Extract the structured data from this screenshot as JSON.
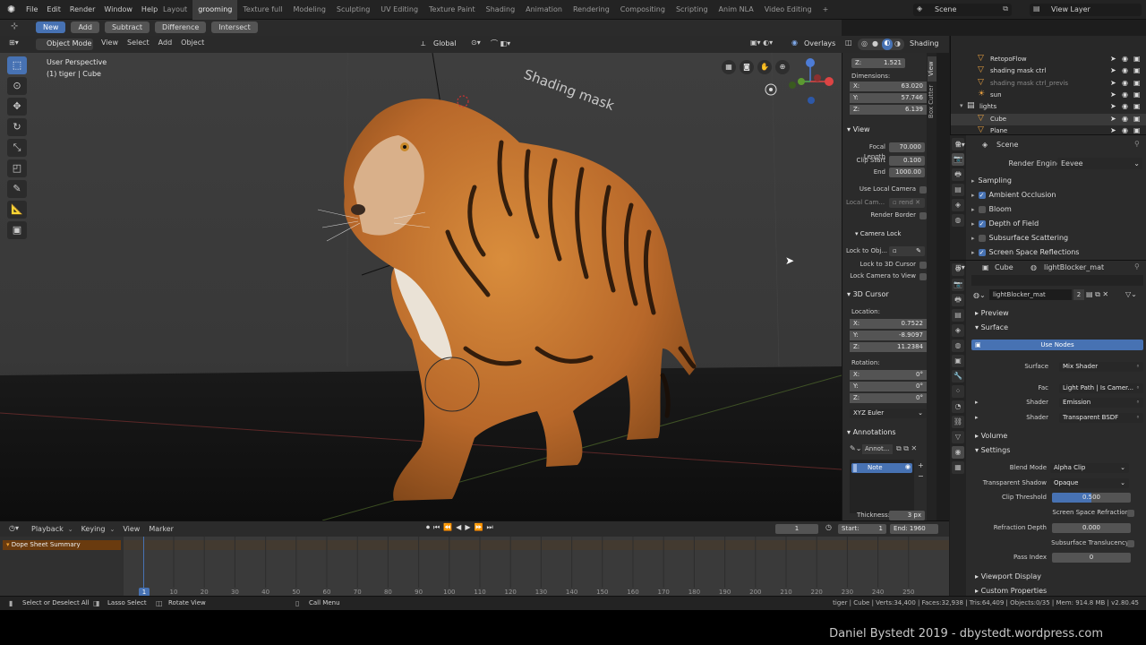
{
  "topbar": {
    "menus": [
      "File",
      "Edit",
      "Render",
      "Window",
      "Help"
    ],
    "workspaces": [
      "Layout",
      "grooming",
      "Texture full",
      "Modeling",
      "Sculpting",
      "UV Editing",
      "Texture Paint",
      "Shading",
      "Animation",
      "Rendering",
      "Compositing",
      "Scripting",
      "Anim NLA",
      "Video Editing",
      "+"
    ],
    "active_workspace": "grooming",
    "scene": "Scene",
    "view_layer": "View Layer"
  },
  "toolheader": {
    "modes": [
      "New",
      "Add",
      "Subtract",
      "Difference",
      "Intersect"
    ]
  },
  "viewport_header": {
    "mode": "Object Mode",
    "menus": [
      "View",
      "Select",
      "Add",
      "Object"
    ],
    "orientation": "Global",
    "overlays": "Overlays",
    "shading": "Shading"
  },
  "viewport": {
    "perspective": "User Perspective",
    "object_info": "(1) tiger | Cube",
    "overlay_text": "Shading mask"
  },
  "npanel": {
    "tabs": [
      "View",
      "Box Cutter"
    ],
    "dim_z_top": "1.521",
    "dimensions_label": "Dimensions:",
    "dimensions": [
      {
        "axis": "X:",
        "value": "63.020"
      },
      {
        "axis": "Y:",
        "value": "57.746"
      },
      {
        "axis": "Z:",
        "value": "6.139"
      }
    ],
    "view_title": "View",
    "focal_length_label": "Focal Length",
    "focal_length": "70.000",
    "clip_start_label": "Clip Start",
    "clip_start": "0.100",
    "clip_end_label": "End",
    "clip_end": "1000.00",
    "use_local_camera": "Use Local Camera",
    "local_camera": "Local Cam...",
    "local_camera_value": "rend",
    "render_border": "Render Border",
    "camera_lock": "Camera Lock",
    "lock_to_obj": "Lock to Obj...",
    "lock_to_3d_cursor": "Lock to 3D Cursor",
    "lock_camera_to_view": "Lock Camera to View",
    "cursor_title": "3D Cursor",
    "location_label": "Location:",
    "location": [
      {
        "axis": "X:",
        "value": "0.7522"
      },
      {
        "axis": "Y:",
        "value": "-8.9097"
      },
      {
        "axis": "Z:",
        "value": "11.2384"
      }
    ],
    "rotation_label": "Rotation:",
    "rotation": [
      {
        "axis": "X:",
        "value": "0°"
      },
      {
        "axis": "Y:",
        "value": "0°"
      },
      {
        "axis": "Z:",
        "value": "0°"
      }
    ],
    "rotation_mode": "XYZ Euler",
    "annotations_title": "Annotations",
    "annot_name": "Annot...",
    "note_layer": "Note",
    "thickness_label": "Thickness:",
    "thickness_value": "3 px"
  },
  "outliner": {
    "items": [
      {
        "name": "RetopoFlow",
        "indent": 2,
        "icon": "object-icon"
      },
      {
        "name": "shading mask ctrl",
        "indent": 2,
        "icon": "object-icon"
      },
      {
        "name": "shading mask ctrl_previs",
        "indent": 2,
        "icon": "object-icon"
      },
      {
        "name": "sun",
        "indent": 2,
        "icon": "light-icon"
      },
      {
        "name": "lights",
        "indent": 1,
        "icon": "collection-icon"
      },
      {
        "name": "Cube",
        "indent": 2,
        "icon": "object-icon"
      },
      {
        "name": "Plane",
        "indent": 2,
        "icon": "object-icon"
      }
    ]
  },
  "scene_props": {
    "title": "Scene",
    "render_engine_label": "Render Engine",
    "render_engine": "Eevee",
    "sections": [
      {
        "name": "Sampling",
        "checkbox": "none"
      },
      {
        "name": "Ambient Occlusion",
        "checkbox": "on"
      },
      {
        "name": "Bloom",
        "checkbox": "off"
      },
      {
        "name": "Depth of Field",
        "checkbox": "on"
      },
      {
        "name": "Subsurface Scattering",
        "checkbox": "off"
      },
      {
        "name": "Screen Space Reflections",
        "checkbox": "on"
      }
    ]
  },
  "material_props": {
    "object": "Cube",
    "material": "lightBlocker_mat",
    "slot_name": "lightBlocker_mat",
    "users": "2",
    "preview": "Preview",
    "surface": "Surface",
    "use_nodes": "Use Nodes",
    "surface_label": "Surface",
    "surface_value": "Mix Shader",
    "fac_label": "Fac",
    "fac_value": "Light Path | Is Camer...",
    "shader1_label": "Shader",
    "shader1_value": "Emission",
    "shader2_label": "Shader",
    "shader2_value": "Transparent BSDF",
    "volume": "Volume",
    "settings": "Settings",
    "blend_mode_label": "Blend Mode",
    "blend_mode": "Alpha Clip",
    "transparent_shadow_label": "Transparent Shadow",
    "transparent_shadow": "Opaque",
    "clip_threshold_label": "Clip Threshold",
    "clip_threshold": "0.500",
    "ssr_label": "Screen Space Refraction",
    "refraction_depth_label": "Refraction Depth",
    "refraction_depth": "0.000",
    "subsurface_translucency_label": "Subsurface Translucency",
    "pass_index_label": "Pass Index",
    "pass_index": "0",
    "viewport_display": "Viewport Display",
    "custom_properties": "Custom Properties"
  },
  "timeline": {
    "menus": [
      "Playback",
      "Keying",
      "View",
      "Marker"
    ],
    "current_frame": "1",
    "start_label": "Start:",
    "start": "1",
    "end_label": "End:",
    "end": "1960",
    "channel": "Dope Sheet Summary",
    "ticks": [
      "10",
      "20",
      "30",
      "40",
      "50",
      "60",
      "70",
      "80",
      "90",
      "100",
      "110",
      "120",
      "130",
      "140",
      "150",
      "160",
      "170",
      "180",
      "190",
      "200",
      "210",
      "220",
      "230",
      "240",
      "250"
    ],
    "playhead_label": "1"
  },
  "statusbar": {
    "left": [
      "Select or Deselect All",
      "Lasso Select",
      "Rotate View",
      "Call Menu"
    ],
    "right": "tiger | Cube | Verts:34,400 | Faces:32,938 | Tris:64,409 | Objects:0/35 | Mem: 914.8 MB | v2.80.45"
  },
  "credit": "Daniel Bystedt 2019 - dbystedt.wordpress.com",
  "colors": {
    "accent": "#4772b3",
    "active_object": "#e8a040",
    "selection": "#ff8c00"
  }
}
